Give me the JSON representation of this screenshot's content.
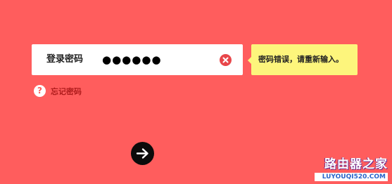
{
  "login": {
    "password_label": "登录密码",
    "password_value": "●●●●●●",
    "error_message": "密码错误，请重新输入。",
    "forgot_icon": "?",
    "forgot_label": "忘记密码"
  },
  "icons": {
    "clear": "clear-x-icon",
    "forgot": "question-icon",
    "submit": "arrow-right-icon"
  },
  "watermark": {
    "title": "路由器之家",
    "url": "LUYOUQI520.COM"
  },
  "colors": {
    "background": "#ff5d5d",
    "field": "#ffffff",
    "error_tip": "#fdf57c",
    "clear_button": "#e8464a",
    "forgot_text": "#b01d1d",
    "submit_button": "#0b0b0b"
  }
}
